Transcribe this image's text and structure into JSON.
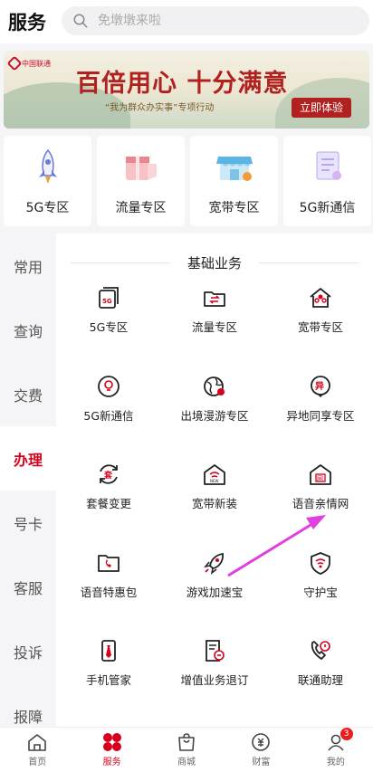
{
  "header": {
    "title": "服务",
    "search_placeholder": "免墩墩来啦"
  },
  "banner": {
    "logo_text": "中国联通",
    "slogan": "百倍用心 十分满意",
    "subtitle": "“我为群众办实事”专项行动",
    "cta": "立即体验"
  },
  "zones": [
    {
      "label": "5G专区",
      "icon": "rocket-icon"
    },
    {
      "label": "流量专区",
      "icon": "gift-box-icon"
    },
    {
      "label": "宽带专区",
      "icon": "store-icon"
    },
    {
      "label": "5G新通信",
      "icon": "document-icon"
    }
  ],
  "sidebar": {
    "items": [
      "常用",
      "查询",
      "交费",
      "办理",
      "号卡",
      "客服",
      "投诉",
      "报障"
    ],
    "active": "办理"
  },
  "section_title": "基础业务",
  "services": [
    {
      "label": "5G专区",
      "icon": "5g-card-icon"
    },
    {
      "label": "流量专区",
      "icon": "traffic-folder-icon"
    },
    {
      "label": "宽带专区",
      "icon": "broadband-house-icon"
    },
    {
      "label": "5G新通信",
      "icon": "lightbulb-icon"
    },
    {
      "label": "出境漫游专区",
      "icon": "globe-icon"
    },
    {
      "label": "异地同享专区",
      "icon": "location-pin-icon"
    },
    {
      "label": "套餐变更",
      "icon": "package-change-icon"
    },
    {
      "label": "宽带新装",
      "icon": "wifi-house-icon"
    },
    {
      "label": "语音亲情网",
      "icon": "family-house-icon"
    },
    {
      "label": "语音特惠包",
      "icon": "voice-folder-icon"
    },
    {
      "label": "游戏加速宝",
      "icon": "rocket-outline-icon"
    },
    {
      "label": "守护宝",
      "icon": "shield-wifi-icon"
    },
    {
      "label": "手机管家",
      "icon": "phone-tie-icon"
    },
    {
      "label": "增值业务退订",
      "icon": "document-stamp-icon"
    },
    {
      "label": "联通助理",
      "icon": "phone-assistant-icon"
    }
  ],
  "tabbar": {
    "items": [
      "首页",
      "服务",
      "商城",
      "财富",
      "我的"
    ],
    "active": "服务",
    "badge": "3"
  },
  "colors": {
    "accent": "#d6001c",
    "annotation_arrow": "#e040e0"
  }
}
